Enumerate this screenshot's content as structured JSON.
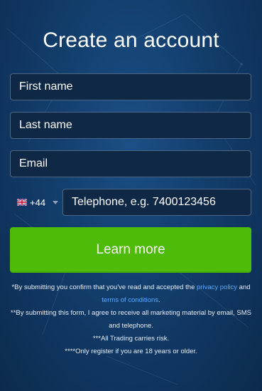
{
  "title": "Create an account",
  "form": {
    "first_name_placeholder": "First name",
    "last_name_placeholder": "Last name",
    "email_placeholder": "Email",
    "country_code": "+44",
    "country_flag_icon": "uk-flag-icon",
    "phone_placeholder": "Telephone, e.g. 7400123456",
    "submit_label": "Learn more"
  },
  "disclaimer": {
    "line1_prefix": "*By submitting you confirm that you've read and accepted the ",
    "privacy_link": "privacy policy",
    "and": " and ",
    "terms_link": "terms of conditions",
    "line1_suffix": ".",
    "line2": "**By submitting this form, I agree to receive all marketing material by email, SMS and telephone.",
    "line3": "***All Trading carries risk.",
    "line4": "****Only register if you are 18 years or older."
  },
  "colors": {
    "accent_green": "#4dbb07",
    "background": "#123d6b",
    "link": "#5aa9ff"
  }
}
